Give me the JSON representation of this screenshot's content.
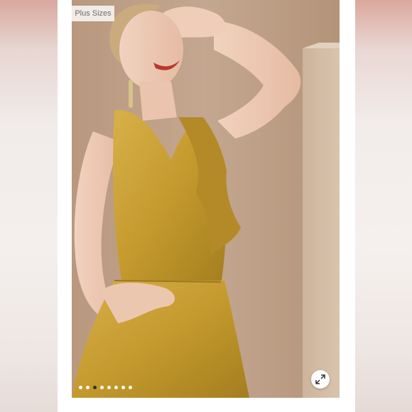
{
  "listing": {
    "badge_label": "Plus Sizes",
    "carousel": {
      "total_slides": 8,
      "active_index": 3
    },
    "expand_icon": "expand-arrows-icon"
  },
  "colors": {
    "dress": "#c9a034",
    "background": "#c0a38c",
    "panel": "#d9c3ae"
  }
}
